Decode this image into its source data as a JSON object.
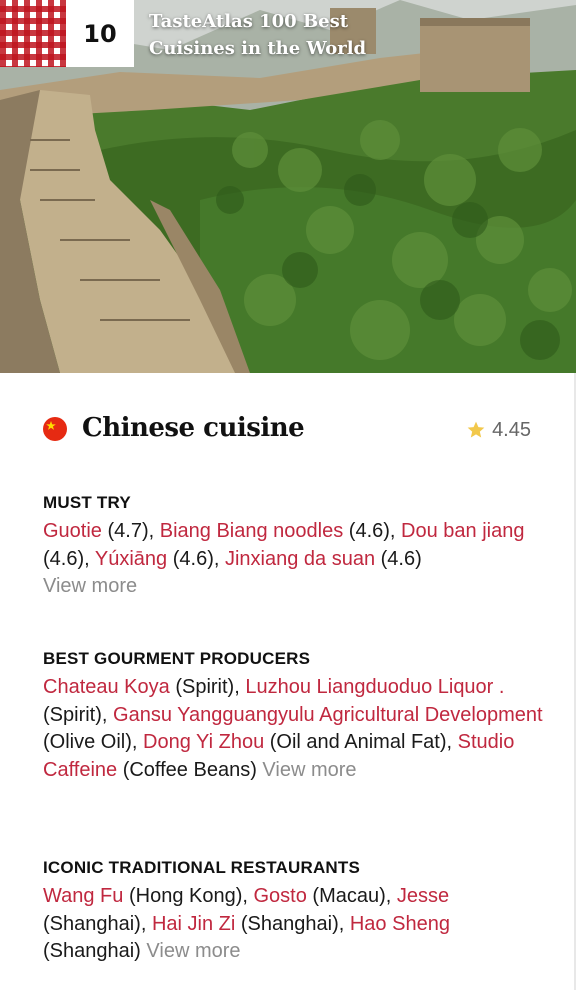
{
  "hero": {
    "rank": "10",
    "title_line1": "TasteAtlas 100 Best",
    "title_line2": "Cuisines in the World"
  },
  "cuisine": {
    "name": "Chinese cuisine",
    "rating": "4.45",
    "flag_icon": "china-flag-icon",
    "star_icon": "star-icon",
    "colors": {
      "accent": "#c0283f",
      "star": "#f2c84b",
      "flag": "#e62a12"
    }
  },
  "must_try": {
    "title": "MUST TRY",
    "items": [
      {
        "name": "Guotie",
        "detail": " (4.7)",
        "sep": ", "
      },
      {
        "name": "Biang Biang noodles",
        "detail": " (4.6)",
        "sep": ", "
      },
      {
        "name": "Dou ban jiang",
        "detail": " (4.6)",
        "sep": ", "
      },
      {
        "name": "Yúxiāng",
        "detail": " (4.6)",
        "sep": ", "
      },
      {
        "name": "Jinxiang da suan",
        "detail": " (4.6)",
        "sep": ""
      }
    ],
    "view_more": "View more"
  },
  "producers": {
    "title": "BEST GOURMENT PRODUCERS",
    "items": [
      {
        "name": "Chateau Koya",
        "detail": " (Spirit)",
        "sep": ", "
      },
      {
        "name": "Luzhou Liangduoduo Liquor .",
        "detail": " (Spirit)",
        "sep": ", "
      },
      {
        "name": "Gansu Yangguangyulu Agricultural Development",
        "detail": " (Olive Oil)",
        "sep": ", "
      },
      {
        "name": "Dong Yi Zhou",
        "detail": " (Oil and Animal Fat)",
        "sep": ", "
      },
      {
        "name": "Studio Caffeine",
        "detail": " (Coffee Beans)",
        "sep": " "
      }
    ],
    "view_more": "View more"
  },
  "restaurants": {
    "title": "ICONIC TRADITIONAL RESTAURANTS",
    "items": [
      {
        "name": "Wang Fu",
        "detail": " (Hong Kong)",
        "sep": ", "
      },
      {
        "name": "Gosto",
        "detail": " (Macau)",
        "sep": ", "
      },
      {
        "name": "Jesse",
        "detail": " (Shanghai)",
        "sep": ", "
      },
      {
        "name": "Hai Jin Zi",
        "detail": " (Shanghai)",
        "sep": ", "
      },
      {
        "name": "Hao Sheng",
        "detail": " (Shanghai)",
        "sep": " "
      }
    ],
    "view_more": "View more"
  }
}
